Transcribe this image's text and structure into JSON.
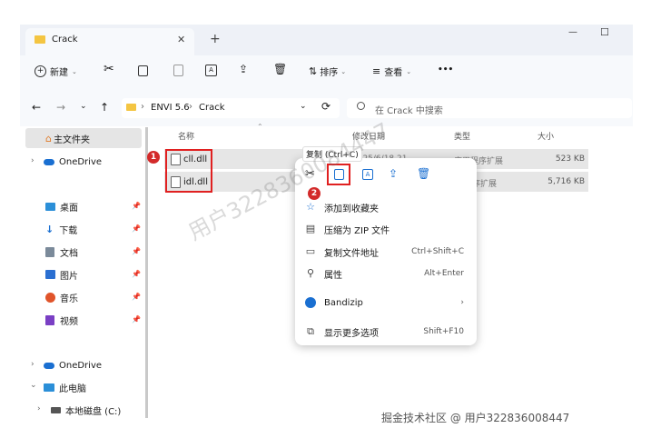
{
  "window": {
    "tab_title": "Crack",
    "tab_close": "✕",
    "new_tab": "+",
    "minimize": "—",
    "maximize": "☐"
  },
  "toolbar": {
    "new_label": "新建",
    "sort_label": "排序",
    "view_label": "查看",
    "more_label": "•••"
  },
  "address": {
    "path": [
      "ENVI 5.6",
      "Crack"
    ],
    "separator": "›",
    "search_placeholder": "在 Crack 中搜索"
  },
  "sidebar": {
    "home": "主文件夹",
    "onedrive_top": "OneDrive",
    "quick": [
      "桌面",
      "下载",
      "文档",
      "图片",
      "音乐",
      "视频"
    ],
    "onedrive_bottom": "OneDrive",
    "this_pc": "此电脑",
    "local_disk": "本地磁盘 (C:)"
  },
  "columns": {
    "name": "名称",
    "modified": "修改日期",
    "type": "类型",
    "size": "大小"
  },
  "files": [
    {
      "name": "cll.dll",
      "modified": "2025/6/18 21",
      "type": "应用程序扩展",
      "size": "523 KB"
    },
    {
      "name": "idl.dll",
      "modified": "",
      "type": "序扩展",
      "size": "5,716 KB"
    }
  ],
  "tooltip": "复制 (Ctrl+C)",
  "badges": [
    "1",
    "2"
  ],
  "context_menu": {
    "items": [
      {
        "label": "添加到收藏夹",
        "shortcut": ""
      },
      {
        "label": "压缩为 ZIP 文件",
        "shortcut": ""
      },
      {
        "label": "复制文件地址",
        "shortcut": "Ctrl+Shift+C"
      },
      {
        "label": "属性",
        "shortcut": "Alt+Enter"
      },
      {
        "label": "Bandizip",
        "shortcut": "›"
      },
      {
        "label": "显示更多选项",
        "shortcut": "Shift+F10"
      }
    ]
  },
  "watermark": "用户3228360084447",
  "footer_credit": "掘金技术社区 @ 用户322836008447",
  "colors": {
    "accent": "#1a6fd1",
    "highlight_red": "#e02020",
    "folder_yellow": "#f4c542"
  }
}
